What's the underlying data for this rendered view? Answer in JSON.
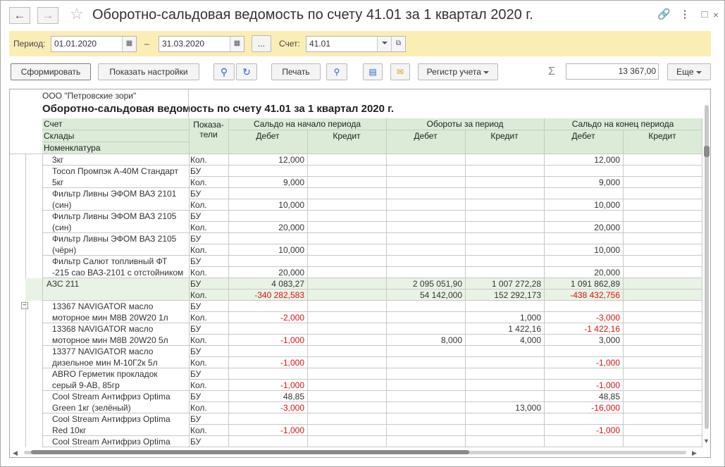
{
  "window": {
    "title": "Оборотно-сальдовая ведомость по счету 41.01 за 1 квартал 2020 г."
  },
  "filter": {
    "period_label": "Период:",
    "date_from": "01.01.2020",
    "dash": "–",
    "date_to": "31.03.2020",
    "more_label": "...",
    "account_label": "Счет:",
    "account": "41.01"
  },
  "toolbar": {
    "generate": "Сформировать",
    "show_settings": "Показать настройки",
    "print": "Печать",
    "register": "Регистр учета",
    "sum_symbol": "Σ",
    "total": "13 367,00",
    "more": "Еще"
  },
  "report": {
    "org": "ООО \"Петровские зори\"",
    "heading": "Оборотно-сальдовая ведомость по счету 41.01 за 1 квартал 2020 г.",
    "hdr": {
      "schet": "Счет",
      "sklady": "Склады",
      "nomenklatura": "Номенклатура",
      "pokazateli": "Показа-\nтели",
      "start": "Сальдо на начало периода",
      "turnover": "Обороты за период",
      "end": "Сальдо на конец периода",
      "debet": "Дебет",
      "kredit": "Кредит"
    },
    "rows": [
      {
        "name": [
          "3кг"
        ],
        "lines": [
          [
            "Кол.",
            "12,000",
            "",
            "",
            "",
            "12,000",
            ""
          ]
        ]
      },
      {
        "name": [
          "Тосол Промпэк А-40М Стандарт",
          "5кг"
        ],
        "lines": [
          [
            "БУ",
            "",
            "",
            "",
            "",
            "",
            ""
          ],
          [
            "Кол.",
            "9,000",
            "",
            "",
            "",
            "9,000",
            ""
          ]
        ]
      },
      {
        "name": [
          "Фильтр Ливны ЭФОМ ВАЗ 2101",
          "(син)"
        ],
        "lines": [
          [
            "БУ",
            "",
            "",
            "",
            "",
            "",
            ""
          ],
          [
            "Кол.",
            "10,000",
            "",
            "",
            "",
            "10,000",
            ""
          ]
        ]
      },
      {
        "name": [
          "Фильтр Ливны ЭФОМ ВАЗ 2105",
          "(син)"
        ],
        "lines": [
          [
            "БУ",
            "",
            "",
            "",
            "",
            "",
            ""
          ],
          [
            "Кол.",
            "20,000",
            "",
            "",
            "",
            "20,000",
            ""
          ]
        ]
      },
      {
        "name": [
          "Фильтр Ливны ЭФОМ ВАЗ 2105",
          "(чёрн)"
        ],
        "lines": [
          [
            "БУ",
            "",
            "",
            "",
            "",
            "",
            ""
          ],
          [
            "Кол.",
            "10,000",
            "",
            "",
            "",
            "10,000",
            ""
          ]
        ]
      },
      {
        "name": [
          "Фильтр Салют топливный ФТ",
          "-215 сао ВАЗ-2101 с отстойником"
        ],
        "lines": [
          [
            "БУ",
            "",
            "",
            "",
            "",
            "",
            ""
          ],
          [
            "Кол.",
            "20,000",
            "",
            "",
            "",
            "20,000",
            ""
          ]
        ]
      },
      {
        "group": true,
        "name": [
          "АЗС 211"
        ],
        "lines": [
          [
            "БУ",
            "4 083,27",
            "",
            "2 095 051,90",
            "1 007 272,28",
            "1 091 862,89",
            ""
          ],
          [
            "Кол.",
            "-340 282,583",
            "",
            "54 142,000",
            "152 292,173",
            "-438 432,756",
            ""
          ]
        ]
      },
      {
        "name": [
          "13367 NAVIGATOR масло",
          "моторное мин М8В 20W20 1л"
        ],
        "lines": [
          [
            "БУ",
            "",
            "",
            "",
            "",
            "",
            ""
          ],
          [
            "Кол.",
            "-2,000",
            "",
            "",
            "1,000",
            "-3,000",
            ""
          ]
        ]
      },
      {
        "name": [
          "13368 NAVIGATOR масло",
          "моторное мин М8В 20W20 5л"
        ],
        "lines": [
          [
            "БУ",
            "",
            "",
            "",
            "1 422,16",
            "-1 422,16",
            ""
          ],
          [
            "Кол.",
            "-1,000",
            "",
            "8,000",
            "4,000",
            "3,000",
            ""
          ]
        ]
      },
      {
        "name": [
          "13377 NAVIGATOR масло",
          "дизельное мин М-10Г2к  5л"
        ],
        "lines": [
          [
            "БУ",
            "",
            "",
            "",
            "",
            "",
            ""
          ],
          [
            "Кол.",
            "-1,000",
            "",
            "",
            "",
            "-1,000",
            ""
          ]
        ]
      },
      {
        "name": [
          "ABRO Герметик прокладок",
          "серый 9-АВ, 85гр"
        ],
        "lines": [
          [
            "БУ",
            "",
            "",
            "",
            "",
            "",
            ""
          ],
          [
            "Кол.",
            "-1,000",
            "",
            "",
            "",
            "-1,000",
            ""
          ]
        ]
      },
      {
        "name": [
          "Cool Stream Антифриз Optima",
          "Green 1кг (зелёный)"
        ],
        "lines": [
          [
            "БУ",
            "48,85",
            "",
            "",
            "",
            "48,85",
            ""
          ],
          [
            "Кол.",
            "-3,000",
            "",
            "",
            "13,000",
            "-16,000",
            ""
          ]
        ]
      },
      {
        "name": [
          "Cool Stream Антифриз Optima",
          "Red 10кг"
        ],
        "lines": [
          [
            "БУ",
            "",
            "",
            "",
            "",
            "",
            ""
          ],
          [
            "Кол.",
            "-1,000",
            "",
            "",
            "",
            "-1,000",
            ""
          ]
        ]
      },
      {
        "name": [
          "Cool Stream Антифриз Optima"
        ],
        "lines": [
          [
            "БУ",
            "",
            "",
            "",
            "",
            "",
            ""
          ]
        ]
      }
    ]
  },
  "colors": {
    "filter_bg": "#fbeeb5",
    "header_bg": "#dbebd7",
    "group_bg": "#e9f3e5",
    "negative": "#dd1111"
  }
}
